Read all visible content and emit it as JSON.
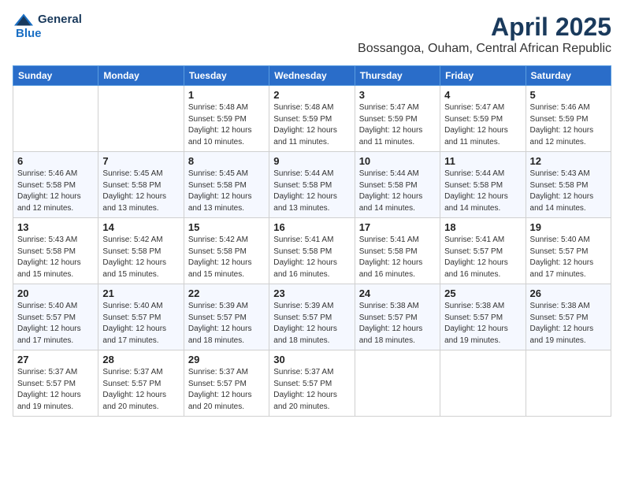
{
  "header": {
    "logo_general": "General",
    "logo_blue": "Blue",
    "month_title": "April 2025",
    "location": "Bossangoa, Ouham, Central African Republic"
  },
  "days_of_week": [
    "Sunday",
    "Monday",
    "Tuesday",
    "Wednesday",
    "Thursday",
    "Friday",
    "Saturday"
  ],
  "weeks": [
    [
      {
        "day": "",
        "info": ""
      },
      {
        "day": "",
        "info": ""
      },
      {
        "day": "1",
        "info": "Sunrise: 5:48 AM\nSunset: 5:59 PM\nDaylight: 12 hours and 10 minutes."
      },
      {
        "day": "2",
        "info": "Sunrise: 5:48 AM\nSunset: 5:59 PM\nDaylight: 12 hours and 11 minutes."
      },
      {
        "day": "3",
        "info": "Sunrise: 5:47 AM\nSunset: 5:59 PM\nDaylight: 12 hours and 11 minutes."
      },
      {
        "day": "4",
        "info": "Sunrise: 5:47 AM\nSunset: 5:59 PM\nDaylight: 12 hours and 11 minutes."
      },
      {
        "day": "5",
        "info": "Sunrise: 5:46 AM\nSunset: 5:59 PM\nDaylight: 12 hours and 12 minutes."
      }
    ],
    [
      {
        "day": "6",
        "info": "Sunrise: 5:46 AM\nSunset: 5:58 PM\nDaylight: 12 hours and 12 minutes."
      },
      {
        "day": "7",
        "info": "Sunrise: 5:45 AM\nSunset: 5:58 PM\nDaylight: 12 hours and 13 minutes."
      },
      {
        "day": "8",
        "info": "Sunrise: 5:45 AM\nSunset: 5:58 PM\nDaylight: 12 hours and 13 minutes."
      },
      {
        "day": "9",
        "info": "Sunrise: 5:44 AM\nSunset: 5:58 PM\nDaylight: 12 hours and 13 minutes."
      },
      {
        "day": "10",
        "info": "Sunrise: 5:44 AM\nSunset: 5:58 PM\nDaylight: 12 hours and 14 minutes."
      },
      {
        "day": "11",
        "info": "Sunrise: 5:44 AM\nSunset: 5:58 PM\nDaylight: 12 hours and 14 minutes."
      },
      {
        "day": "12",
        "info": "Sunrise: 5:43 AM\nSunset: 5:58 PM\nDaylight: 12 hours and 14 minutes."
      }
    ],
    [
      {
        "day": "13",
        "info": "Sunrise: 5:43 AM\nSunset: 5:58 PM\nDaylight: 12 hours and 15 minutes."
      },
      {
        "day": "14",
        "info": "Sunrise: 5:42 AM\nSunset: 5:58 PM\nDaylight: 12 hours and 15 minutes."
      },
      {
        "day": "15",
        "info": "Sunrise: 5:42 AM\nSunset: 5:58 PM\nDaylight: 12 hours and 15 minutes."
      },
      {
        "day": "16",
        "info": "Sunrise: 5:41 AM\nSunset: 5:58 PM\nDaylight: 12 hours and 16 minutes."
      },
      {
        "day": "17",
        "info": "Sunrise: 5:41 AM\nSunset: 5:58 PM\nDaylight: 12 hours and 16 minutes."
      },
      {
        "day": "18",
        "info": "Sunrise: 5:41 AM\nSunset: 5:57 PM\nDaylight: 12 hours and 16 minutes."
      },
      {
        "day": "19",
        "info": "Sunrise: 5:40 AM\nSunset: 5:57 PM\nDaylight: 12 hours and 17 minutes."
      }
    ],
    [
      {
        "day": "20",
        "info": "Sunrise: 5:40 AM\nSunset: 5:57 PM\nDaylight: 12 hours and 17 minutes."
      },
      {
        "day": "21",
        "info": "Sunrise: 5:40 AM\nSunset: 5:57 PM\nDaylight: 12 hours and 17 minutes."
      },
      {
        "day": "22",
        "info": "Sunrise: 5:39 AM\nSunset: 5:57 PM\nDaylight: 12 hours and 18 minutes."
      },
      {
        "day": "23",
        "info": "Sunrise: 5:39 AM\nSunset: 5:57 PM\nDaylight: 12 hours and 18 minutes."
      },
      {
        "day": "24",
        "info": "Sunrise: 5:38 AM\nSunset: 5:57 PM\nDaylight: 12 hours and 18 minutes."
      },
      {
        "day": "25",
        "info": "Sunrise: 5:38 AM\nSunset: 5:57 PM\nDaylight: 12 hours and 19 minutes."
      },
      {
        "day": "26",
        "info": "Sunrise: 5:38 AM\nSunset: 5:57 PM\nDaylight: 12 hours and 19 minutes."
      }
    ],
    [
      {
        "day": "27",
        "info": "Sunrise: 5:37 AM\nSunset: 5:57 PM\nDaylight: 12 hours and 19 minutes."
      },
      {
        "day": "28",
        "info": "Sunrise: 5:37 AM\nSunset: 5:57 PM\nDaylight: 12 hours and 20 minutes."
      },
      {
        "day": "29",
        "info": "Sunrise: 5:37 AM\nSunset: 5:57 PM\nDaylight: 12 hours and 20 minutes."
      },
      {
        "day": "30",
        "info": "Sunrise: 5:37 AM\nSunset: 5:57 PM\nDaylight: 12 hours and 20 minutes."
      },
      {
        "day": "",
        "info": ""
      },
      {
        "day": "",
        "info": ""
      },
      {
        "day": "",
        "info": ""
      }
    ]
  ]
}
